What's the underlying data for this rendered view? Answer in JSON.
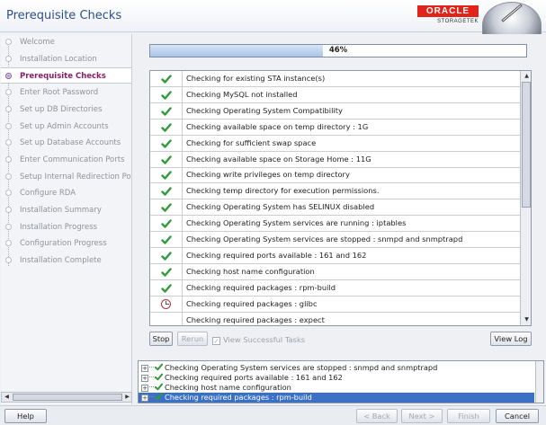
{
  "window": {
    "title": "Prerequisite Checks"
  },
  "branding": {
    "brand": "ORACLE",
    "product": "STORAGETEK",
    "accent": "#e2231a"
  },
  "nav": {
    "items": [
      {
        "label": "Welcome",
        "state": "done"
      },
      {
        "label": "Installation Location",
        "state": "done"
      },
      {
        "label": "Prerequisite Checks",
        "state": "active"
      },
      {
        "label": "Enter Root Password",
        "state": "pending"
      },
      {
        "label": "Set up DB Directories",
        "state": "pending"
      },
      {
        "label": "Set up Admin Accounts",
        "state": "pending"
      },
      {
        "label": "Set up Database Accounts",
        "state": "pending"
      },
      {
        "label": "Enter Communication Ports",
        "state": "pending"
      },
      {
        "label": "Setup Internal Redirection Port",
        "state": "pending"
      },
      {
        "label": "Configure RDA",
        "state": "pending"
      },
      {
        "label": "Installation Summary",
        "state": "pending"
      },
      {
        "label": "Installation Progress",
        "state": "pending"
      },
      {
        "label": "Configuration Progress",
        "state": "pending"
      },
      {
        "label": "Installation Complete",
        "state": "pending"
      }
    ]
  },
  "progress": {
    "value": 0.46,
    "text": "46%"
  },
  "checks": [
    {
      "status": "passed",
      "icon": "check-icon",
      "text": "Checking for existing STA instance(s)"
    },
    {
      "status": "passed",
      "icon": "check-icon",
      "text": "Checking MySQL not installed"
    },
    {
      "status": "passed",
      "icon": "check-icon",
      "text": "Checking Operating System Compatibility"
    },
    {
      "status": "passed",
      "icon": "check-icon",
      "text": "Checking available space on temp directory : 1G"
    },
    {
      "status": "passed",
      "icon": "check-icon",
      "text": "Checking for sufficient swap space"
    },
    {
      "status": "passed",
      "icon": "check-icon",
      "text": "Checking available space on Storage Home : 11G"
    },
    {
      "status": "passed",
      "icon": "check-icon",
      "text": "Checking write privileges on temp directory"
    },
    {
      "status": "passed",
      "icon": "check-icon",
      "text": "Checking temp directory for execution permissions."
    },
    {
      "status": "passed",
      "icon": "check-icon",
      "text": "Checking Operating System has SELINUX disabled"
    },
    {
      "status": "passed",
      "icon": "check-icon",
      "text": "Checking Operating System services are running : iptables"
    },
    {
      "status": "passed",
      "icon": "check-icon",
      "text": "Checking Operating System services are stopped : snmpd and snmptrapd"
    },
    {
      "status": "passed",
      "icon": "check-icon",
      "text": "Checking required ports available : 161 and 162"
    },
    {
      "status": "passed",
      "icon": "check-icon",
      "text": "Checking host name configuration"
    },
    {
      "status": "passed",
      "icon": "check-icon",
      "text": "Checking required packages : rpm-build"
    },
    {
      "status": "in-progress",
      "icon": "clock-icon",
      "text": "Checking required packages : glibc"
    },
    {
      "status": "pending",
      "icon": "",
      "text": "Checking required packages : expect"
    }
  ],
  "actions": {
    "stop": "Stop",
    "rerun": "Rerun",
    "view_successful": "View Successful Tasks",
    "view_successful_checked": true,
    "view_log": "View Log"
  },
  "log": [
    {
      "text": "Checking Operating System services are stopped : snmpd and snmptrapd",
      "selected": false
    },
    {
      "text": "Checking required ports available : 161 and 162",
      "selected": false
    },
    {
      "text": "Checking host name configuration",
      "selected": false
    },
    {
      "text": "Checking required packages : rpm-build",
      "selected": true
    }
  ],
  "footer": {
    "help": "Help",
    "back": "< Back",
    "next": "Next >",
    "finish": "Finish",
    "cancel": "Cancel"
  }
}
